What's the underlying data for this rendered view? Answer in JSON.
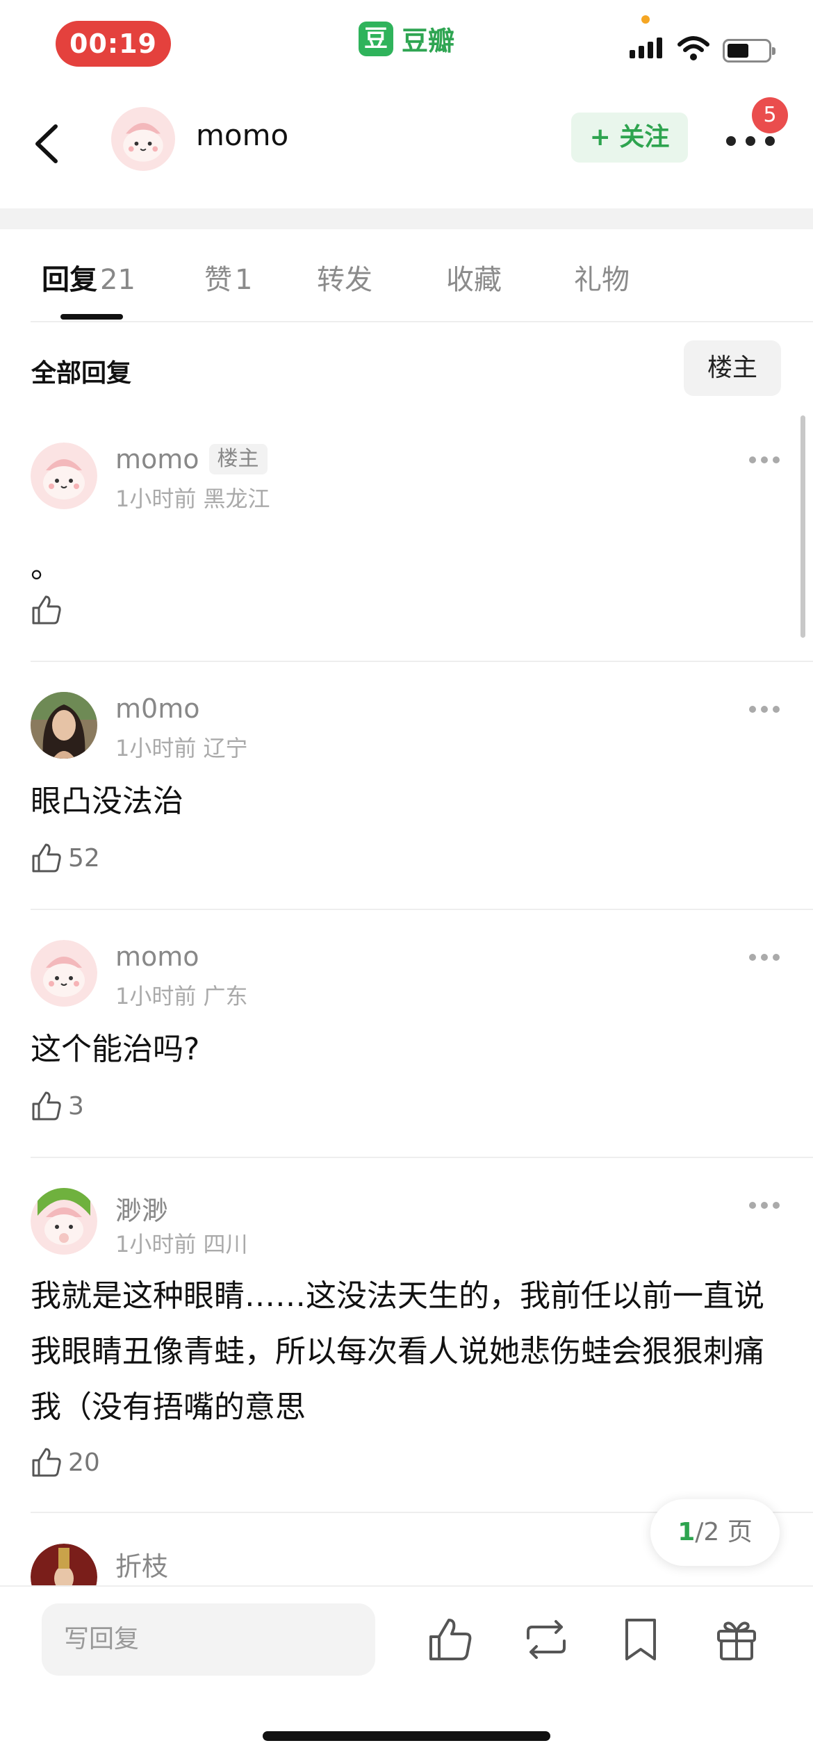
{
  "status_bar": {
    "time": "00:19",
    "app_logo_char": "豆",
    "app_name": "豆瓣"
  },
  "header": {
    "user_name": "momo",
    "follow_label": "+ 关注",
    "notification_count": "5"
  },
  "tabs": [
    {
      "label": "回复",
      "count": "21"
    },
    {
      "label": "赞",
      "count": "1"
    },
    {
      "label": "转发",
      "count": ""
    },
    {
      "label": "收藏",
      "count": ""
    },
    {
      "label": "礼物",
      "count": ""
    }
  ],
  "filter": {
    "title": "全部回复",
    "op_only_label": "楼主"
  },
  "comments": [
    {
      "name": "momo",
      "op_badge": "楼主",
      "meta": "1小时前 黑龙江",
      "text": "。",
      "likes": ""
    },
    {
      "name": "m0mo",
      "op_badge": "",
      "meta": "1小时前 辽宁",
      "text": "眼凸没法治",
      "likes": "52"
    },
    {
      "name": "momo",
      "op_badge": "",
      "meta": "1小时前 广东",
      "text": "这个能治吗?",
      "likes": "3"
    },
    {
      "name": "渺渺",
      "op_badge": "",
      "meta": "1小时前 四川",
      "text": "我就是这种眼睛……这没法天生的，我前任以前一直说我眼睛丑像青蛙，所以每次看人说她悲伤蛙会狠狠刺痛我（没有捂嘴的意思",
      "likes": "20"
    },
    {
      "name": "折枝",
      "op_badge": "",
      "meta": "",
      "text": "",
      "likes": ""
    }
  ],
  "pagination": {
    "current": "1",
    "total_text": "/2 页"
  },
  "bottom_bar": {
    "reply_placeholder": "写回复"
  },
  "colors": {
    "accent_green": "#2ea44f",
    "time_pill": "#e4413d",
    "badge_red": "#ea4d4d"
  }
}
